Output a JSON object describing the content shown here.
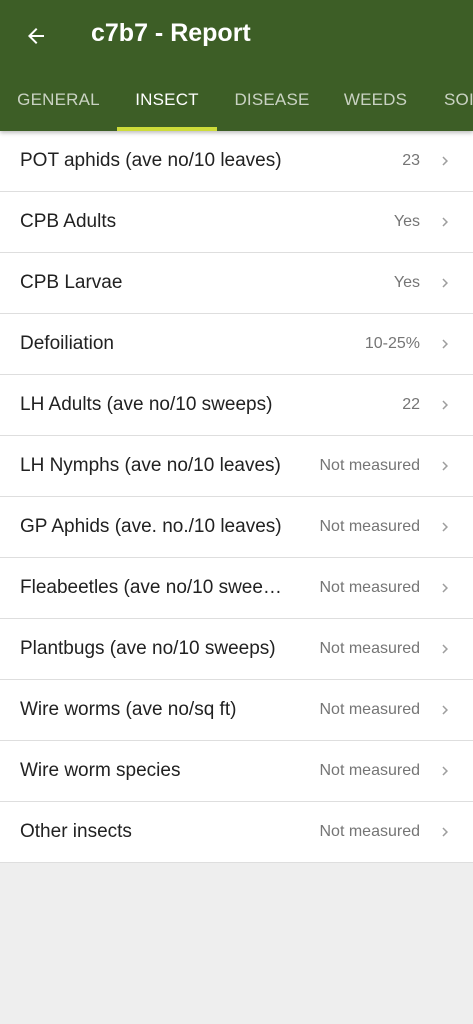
{
  "appbar": {
    "title": "c7b7 - Report",
    "background_color": "#3d5e26",
    "back_icon": "arrow-left-icon"
  },
  "tabs": [
    {
      "label": "GENERAL",
      "active": false
    },
    {
      "label": "INSECT",
      "active": true
    },
    {
      "label": "DISEASE",
      "active": false
    },
    {
      "label": "WEEDS",
      "active": false
    },
    {
      "label": "SOI",
      "active": false
    }
  ],
  "tab_indicator_color": "#cddc39",
  "items": [
    {
      "label": "POT aphids (ave no/10 leaves)",
      "value": "23"
    },
    {
      "label": "CPB Adults",
      "value": "Yes"
    },
    {
      "label": "CPB Larvae",
      "value": "Yes"
    },
    {
      "label": "Defoiliation",
      "value": "10-25%"
    },
    {
      "label": "LH Adults (ave no/10 sweeps)",
      "value": "22"
    },
    {
      "label": "LH Nymphs (ave no/10 leaves)",
      "value": "Not measured"
    },
    {
      "label": "GP Aphids (ave. no./10 leaves)",
      "value": "Not measured"
    },
    {
      "label": "Fleabeetles (ave no/10 swee…",
      "value": "Not measured"
    },
    {
      "label": "Plantbugs (ave no/10 sweeps)",
      "value": "Not measured"
    },
    {
      "label": "Wire worms (ave no/sq ft)",
      "value": "Not measured"
    },
    {
      "label": "Wire worm species",
      "value": "Not measured"
    },
    {
      "label": "Other insects",
      "value": "Not measured"
    }
  ]
}
